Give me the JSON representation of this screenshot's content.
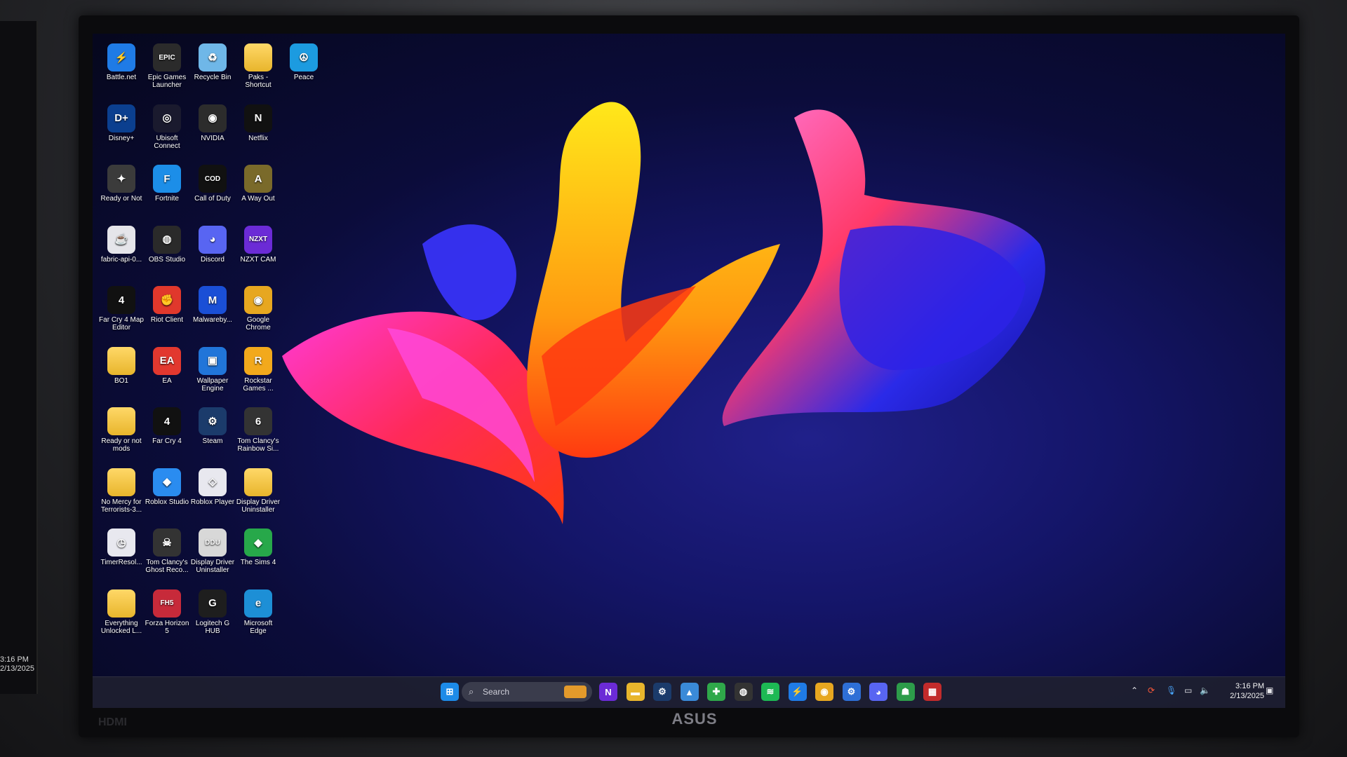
{
  "left_clock": {
    "time": "3:16 PM",
    "date": "2/13/2025"
  },
  "monitor": {
    "brand": "ASUS",
    "input_label": "HDMI"
  },
  "desktop_icons": [
    {
      "label": "Battle.net",
      "icon": "battlenet-icon",
      "color": "#1f7be6",
      "glyph": "⚡"
    },
    {
      "label": "Epic Games Launcher",
      "icon": "epic-games-icon",
      "color": "#2b2b2b",
      "glyph": "EPIC"
    },
    {
      "label": "Recycle Bin",
      "icon": "recycle-bin-icon",
      "color": "#6fb7e8",
      "glyph": "♻"
    },
    {
      "label": "Paks - Shortcut",
      "icon": "folder-icon",
      "color": "folder",
      "glyph": ""
    },
    {
      "label": "Peace",
      "icon": "peace-icon",
      "color": "#1c9be0",
      "glyph": "☮"
    },
    {
      "label": "Disney+",
      "icon": "disney-plus-icon",
      "color": "#0b3f8f",
      "glyph": "D+"
    },
    {
      "label": "Ubisoft Connect",
      "icon": "ubisoft-icon",
      "color": "#1a1a2e",
      "glyph": "◎"
    },
    {
      "label": "NVIDIA",
      "icon": "nvidia-icon",
      "color": "#2c2c2c",
      "glyph": "◉"
    },
    {
      "label": "Netflix",
      "icon": "netflix-icon",
      "color": "#111",
      "glyph": "N"
    },
    {
      "label": "Ready or Not",
      "icon": "ready-or-not-icon",
      "color": "#3b3b3b",
      "glyph": "✦"
    },
    {
      "label": "Fortnite",
      "icon": "fortnite-icon",
      "color": "#1c8ee8",
      "glyph": "F"
    },
    {
      "label": "Call of Duty",
      "icon": "call-of-duty-icon",
      "color": "#111",
      "glyph": "COD"
    },
    {
      "label": "A Way Out",
      "icon": "a-way-out-icon",
      "color": "#7a6a2a",
      "glyph": "A"
    },
    {
      "label": "fabric-api-0...",
      "icon": "java-icon",
      "color": "#e5e5ea",
      "glyph": "☕"
    },
    {
      "label": "OBS Studio",
      "icon": "obs-icon",
      "color": "#2a2a2a",
      "glyph": "◍"
    },
    {
      "label": "Discord",
      "icon": "discord-icon",
      "color": "#5865f2",
      "glyph": "◕"
    },
    {
      "label": "NZXT CAM",
      "icon": "nzxt-icon",
      "color": "#6b2bd6",
      "glyph": "NZXT"
    },
    {
      "label": "Far Cry 4 Map Editor",
      "icon": "far-cry-icon",
      "color": "#111",
      "glyph": "4"
    },
    {
      "label": "Riot Client",
      "icon": "riot-icon",
      "color": "#e0382c",
      "glyph": "✊"
    },
    {
      "label": "Malwareby...",
      "icon": "malwarebytes-icon",
      "color": "#1a4fd6",
      "glyph": "M"
    },
    {
      "label": "Google Chrome",
      "icon": "chrome-icon",
      "color": "#e7a720",
      "glyph": "◉"
    },
    {
      "label": "BO1",
      "icon": "folder-icon",
      "color": "folder",
      "glyph": ""
    },
    {
      "label": "EA",
      "icon": "ea-icon",
      "color": "#e2382f",
      "glyph": "EA"
    },
    {
      "label": "Wallpaper Engine",
      "icon": "wallpaper-engine-icon",
      "color": "#2175d9",
      "glyph": "▣"
    },
    {
      "label": "Rockstar Games ...",
      "icon": "rockstar-icon",
      "color": "#f2a91c",
      "glyph": "R"
    },
    {
      "label": "Ready or not mods",
      "icon": "folder-icon",
      "color": "folder",
      "glyph": ""
    },
    {
      "label": "Far Cry 4",
      "icon": "far-cry-4-icon",
      "color": "#111",
      "glyph": "4"
    },
    {
      "label": "Steam",
      "icon": "steam-icon",
      "color": "#1b3b6b",
      "glyph": "⚙"
    },
    {
      "label": "Tom Clancy's Rainbow Si...",
      "icon": "rainbow-six-icon",
      "color": "#333",
      "glyph": "6"
    },
    {
      "label": "No Mercy for Terrorists-3...",
      "icon": "folder-icon",
      "color": "folder",
      "glyph": ""
    },
    {
      "label": "Roblox Studio",
      "icon": "roblox-studio-icon",
      "color": "#2a8cf0",
      "glyph": "◆"
    },
    {
      "label": "Roblox Player",
      "icon": "roblox-player-icon",
      "color": "#e8e8ef",
      "glyph": "◇"
    },
    {
      "label": "Display Driver Uninstaller",
      "icon": "folder-icon",
      "color": "folder",
      "glyph": ""
    },
    {
      "label": "TimerResol...",
      "icon": "timer-icon",
      "color": "#e8e8ef",
      "glyph": "◷"
    },
    {
      "label": "Tom Clancy's Ghost Reco...",
      "icon": "ghost-recon-icon",
      "color": "#333",
      "glyph": "☠"
    },
    {
      "label": "Display Driver Uninstaller",
      "icon": "ddu-icon",
      "color": "#d8d8d8",
      "glyph": "DDU"
    },
    {
      "label": "The Sims 4",
      "icon": "sims-icon",
      "color": "#27a84a",
      "glyph": "◆"
    },
    {
      "label": "Everything Unlocked L...",
      "icon": "folder-icon",
      "color": "folder",
      "glyph": ""
    },
    {
      "label": "Forza Horizon 5",
      "icon": "forza-icon",
      "color": "#c72a3a",
      "glyph": "FH5"
    },
    {
      "label": "Logitech G HUB",
      "icon": "logitech-icon",
      "color": "#1e1e1e",
      "glyph": "G"
    },
    {
      "label": "Microsoft Edge",
      "icon": "edge-icon",
      "color": "#1d8fd6",
      "glyph": "e"
    }
  ],
  "taskbar": {
    "search_placeholder": "Search",
    "pinned": [
      {
        "name": "nzxt-taskbar-icon",
        "color": "#6b2bd6",
        "glyph": "N"
      },
      {
        "name": "file-explorer-icon",
        "color": "#e8b52c",
        "glyph": "▬"
      },
      {
        "name": "steam-taskbar-icon",
        "color": "#1b3b6b",
        "glyph": "⚙"
      },
      {
        "name": "photos-icon",
        "color": "#3a8ad8",
        "glyph": "▲"
      },
      {
        "name": "xbox-icon",
        "color": "#2fa84a",
        "glyph": "✚"
      },
      {
        "name": "obs-taskbar-icon",
        "color": "#333",
        "glyph": "◍"
      },
      {
        "name": "spotify-icon",
        "color": "#1db954",
        "glyph": "≋"
      },
      {
        "name": "battlenet-taskbar-icon",
        "color": "#1f7be6",
        "glyph": "⚡"
      },
      {
        "name": "chrome-taskbar-icon",
        "color": "#e7a720",
        "glyph": "◉"
      },
      {
        "name": "settings-icon",
        "color": "#2e6fd6",
        "glyph": "⚙"
      },
      {
        "name": "discord-taskbar-icon",
        "color": "#5865f2",
        "glyph": "◕"
      },
      {
        "name": "ghost-taskbar-icon",
        "color": "#2d9c4a",
        "glyph": "☗"
      },
      {
        "name": "app-taskbar-icon",
        "color": "#c22b2b",
        "glyph": "▦"
      }
    ],
    "clock_time": "3:16 PM",
    "clock_date": "2/13/2025"
  }
}
